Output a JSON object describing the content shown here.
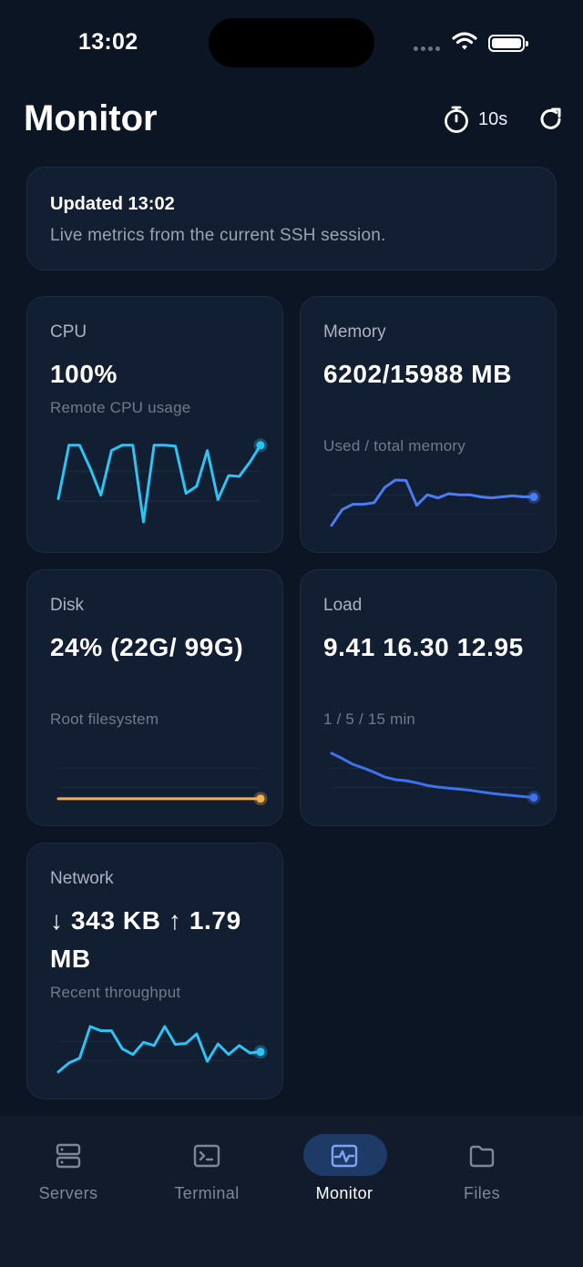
{
  "status_bar": {
    "time": "13:02"
  },
  "header": {
    "title": "Monitor",
    "refresh_interval": "10s",
    "icons": {
      "interval": "stopwatch-icon",
      "refresh": "refresh-icon"
    }
  },
  "info": {
    "updated": "Updated 13:02",
    "subtitle": "Live metrics from the current SSH session."
  },
  "cards": {
    "cpu": {
      "label": "CPU",
      "value": "100%",
      "caption": "Remote CPU usage",
      "color": "#2cc4f5",
      "series": [
        0.28,
        0.88,
        0.88,
        0.62,
        0.32,
        0.82,
        0.88,
        0.88,
        0.02,
        0.88,
        0.88,
        0.87,
        0.34,
        0.42,
        0.82,
        0.27,
        0.54,
        0.53,
        0.69,
        0.88
      ]
    },
    "memory": {
      "label": "Memory",
      "value": "6202/15988 MB",
      "caption": "Used / total memory",
      "color": "#4b7df0",
      "series": [
        0.02,
        0.32,
        0.42,
        0.42,
        0.45,
        0.74,
        0.88,
        0.87,
        0.4,
        0.6,
        0.54,
        0.62,
        0.6,
        0.6,
        0.56,
        0.54,
        0.56,
        0.58,
        0.56,
        0.56
      ]
    },
    "disk": {
      "label": "Disk",
      "value": "24% (22G/ 99G)",
      "caption": "Root filesystem",
      "color": "#f3b04c",
      "series": [
        0.02,
        0.02,
        0.02,
        0.02,
        0.02,
        0.02,
        0.02,
        0.02,
        0.02,
        0.02,
        0.02,
        0.02,
        0.02,
        0.02,
        0.02,
        0.02,
        0.02,
        0.02,
        0.02,
        0.02
      ]
    },
    "load": {
      "label": "Load",
      "value": "9.41 16.30 12.95",
      "caption": "1 / 5 / 15 min",
      "color": "#3f72ee",
      "series": [
        0.88,
        0.78,
        0.67,
        0.6,
        0.52,
        0.43,
        0.38,
        0.36,
        0.32,
        0.27,
        0.24,
        0.22,
        0.2,
        0.18,
        0.15,
        0.12,
        0.1,
        0.08,
        0.06,
        0.04
      ]
    },
    "network": {
      "label": "Network",
      "value": "↓ 343 KB ↑ 1.79 MB",
      "caption": "Recent throughput",
      "color": "#2cc4f5",
      "series": [
        0.02,
        0.19,
        0.28,
        0.88,
        0.8,
        0.8,
        0.46,
        0.35,
        0.58,
        0.52,
        0.88,
        0.54,
        0.56,
        0.74,
        0.22,
        0.55,
        0.35,
        0.52,
        0.38,
        0.4
      ]
    }
  },
  "nav": {
    "items": [
      {
        "label": "Servers",
        "icon": "servers-icon",
        "active": false
      },
      {
        "label": "Terminal",
        "icon": "terminal-icon",
        "active": false
      },
      {
        "label": "Monitor",
        "icon": "monitor-pulse-icon",
        "active": true
      },
      {
        "label": "Files",
        "icon": "folder-icon",
        "active": false
      }
    ]
  }
}
